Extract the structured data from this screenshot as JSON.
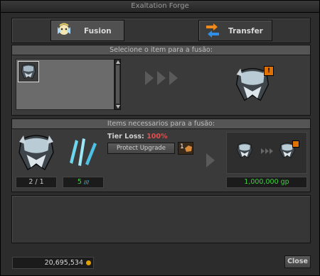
{
  "window": {
    "title": "Exaltation Forge"
  },
  "tabs": [
    {
      "label": "Fusion",
      "icon": "fusion-fairy-icon",
      "active": true
    },
    {
      "label": "Transfer",
      "icon": "transfer-arrows-icon",
      "active": false
    }
  ],
  "select_panel": {
    "header": "Selecione o item para a fusão:"
  },
  "required_panel": {
    "header": "Items necessarios para a fusão:",
    "tier_loss_label": "Tier Loss:",
    "tier_loss_value": "100%",
    "protect_label": "Protect Upgrade",
    "protect_count": "1",
    "item_count": "2 / 1",
    "dust_count": "5",
    "cost": "1,000,000 gp"
  },
  "footer": {
    "balance": "20,695,534",
    "close_label": "Close"
  },
  "colors": {
    "accent_red": "#e05050",
    "gold_green": "#3fd23f",
    "coin": "#e0a000",
    "tier_badge": "#e07000"
  }
}
